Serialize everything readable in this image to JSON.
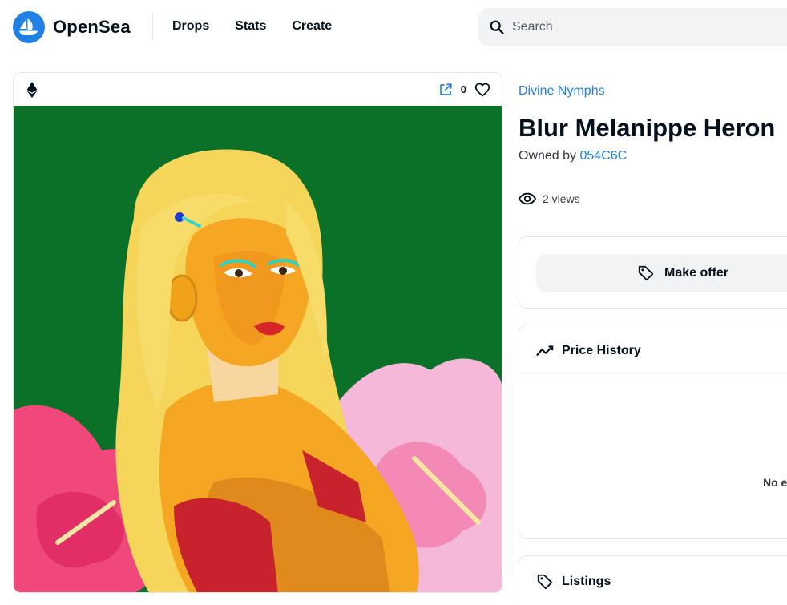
{
  "header": {
    "brand": "OpenSea",
    "nav": [
      "Drops",
      "Stats",
      "Create"
    ],
    "search_placeholder": "Search"
  },
  "asset": {
    "chain_icon": "ethereum-icon",
    "favorites_count": "0",
    "collection": "Divine Nymphs",
    "title": "Blur Melanippe Heron",
    "owned_by_label": "Owned by",
    "owner": "054C6C",
    "views": "2 views"
  },
  "actions": {
    "make_offer": "Make offer"
  },
  "price_history": {
    "title": "Price History",
    "empty_text": "No e"
  },
  "listings": {
    "title": "Listings"
  },
  "colors": {
    "accent": "#2081e2",
    "art_background": "#0b7128",
    "hair": "#f6d55b",
    "skin": "#f5a623",
    "flower_pink": "#f0487a",
    "flower_light_pink": "#f6b8d8"
  }
}
